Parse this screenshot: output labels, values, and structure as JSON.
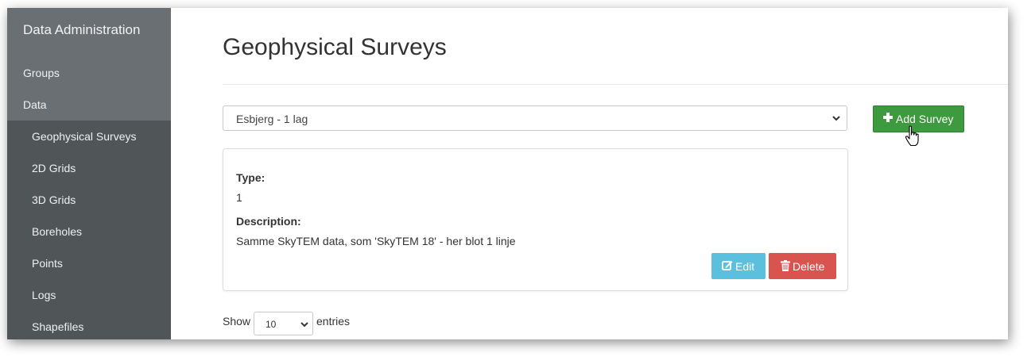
{
  "sidebar": {
    "title": "Data Administration",
    "items": [
      {
        "label": "Groups"
      },
      {
        "label": "Data"
      }
    ],
    "subitems": [
      {
        "label": "Geophysical Surveys"
      },
      {
        "label": "2D Grids"
      },
      {
        "label": "3D Grids"
      },
      {
        "label": "Boreholes"
      },
      {
        "label": "Points"
      },
      {
        "label": "Logs"
      },
      {
        "label": "Shapefiles"
      }
    ]
  },
  "main": {
    "title": "Geophysical Surveys",
    "survey_select": {
      "value": "Esbjerg - 1 lag"
    },
    "add_button": {
      "label": "Add Survey",
      "icon": "plus-icon",
      "color": "#3e9a3e"
    },
    "card": {
      "type_label": "Type:",
      "type_value": "1",
      "description_label": "Description:",
      "description_value": "Samme SkyTEM data, som 'SkyTEM 18' - her blot 1 linje",
      "edit_label": "Edit",
      "edit_icon": "edit-icon",
      "edit_color": "#5bc0de",
      "delete_label": "Delete",
      "delete_icon": "trash-icon",
      "delete_color": "#d9534f"
    },
    "table_length": {
      "show_label": "Show",
      "value": "10",
      "entries_label": "entries"
    }
  }
}
